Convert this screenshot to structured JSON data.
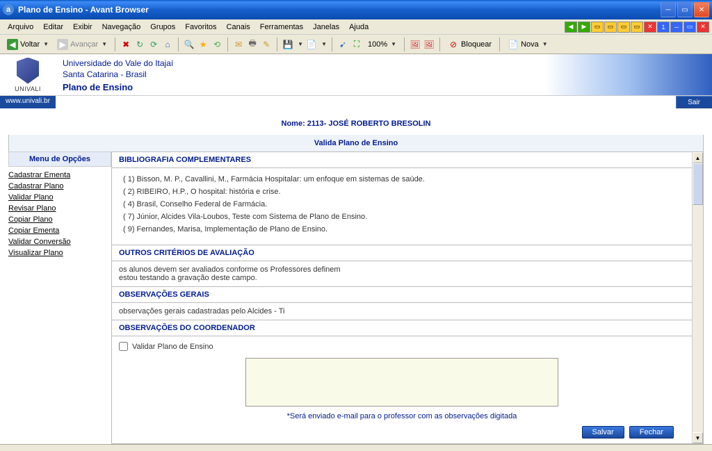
{
  "titlebar": {
    "text": "Plano de Ensino - Avant Browser",
    "icon_letter": "a"
  },
  "menubar": [
    "Arquivo",
    "Editar",
    "Exibir",
    "Navegação",
    "Grupos",
    "Favoritos",
    "Canais",
    "Ferramentas",
    "Janelas",
    "Ajuda"
  ],
  "toolbar": {
    "voltar": "Voltar",
    "avancar": "Avançar",
    "zoom": "100%",
    "bloquear": "Bloquear",
    "nova": "Nova"
  },
  "header": {
    "logo_text": "UNIVALI",
    "line1": "Universidade do Vale do Itajaí",
    "line2": "Santa Catarina - Brasil",
    "line3": "Plano de Ensino"
  },
  "url": "www.univali.br",
  "sair": "Sair",
  "nome_label": "Nome: 2113- JOSÉ ROBERTO BRESOLIN",
  "valida_title": "Valida Plano de Ensino",
  "sidebar": {
    "title": "Menu de Opções",
    "items": [
      "Cadastrar Ementa",
      "Cadastrar Plano",
      "Validar Plano",
      "Revisar Plano",
      "Copiar Plano",
      "Copiar Ementa",
      "Validar Conversão",
      "Visualizar Plano"
    ]
  },
  "sections": {
    "bib_title": "BIBLIOGRAFIA COMPLEMENTARES",
    "bib": [
      "( 1) Bisson, M. P., Cavallini, M., Farmácia Hospitalar: um enfoque em sistemas de saúde.",
      "( 2) RIBEIRO, H.P., O hospital: história e crise.",
      "( 4) Brasil, Conselho Federal de Farmácia.",
      "( 7) Júnior, Alcides Vila-Loubos, Teste com Sistema de Plano de Ensino.",
      "( 9) Fernandes, Marisa, Implementação de Plano de Ensino."
    ],
    "outros_title": "OUTROS CRITÉRIOS DE AVALIAÇÃO",
    "outros_body1": "os alunos devem ser avaliados conforme os Professores definem",
    "outros_body2": "estou testando a gravação deste campo.",
    "obs_title": "OBSERVAÇÕES GERAIS",
    "obs_body": "observações gerais cadastradas pelo Alcides - Ti",
    "coord_title": "OBSERVAÇÕES DO COORDENADOR",
    "checkbox_label": "Validar Plano de Ensino",
    "note": "*Será enviado e-mail para o professor com as observações digitada",
    "salvar": "Salvar",
    "fechar": "Fechar"
  }
}
